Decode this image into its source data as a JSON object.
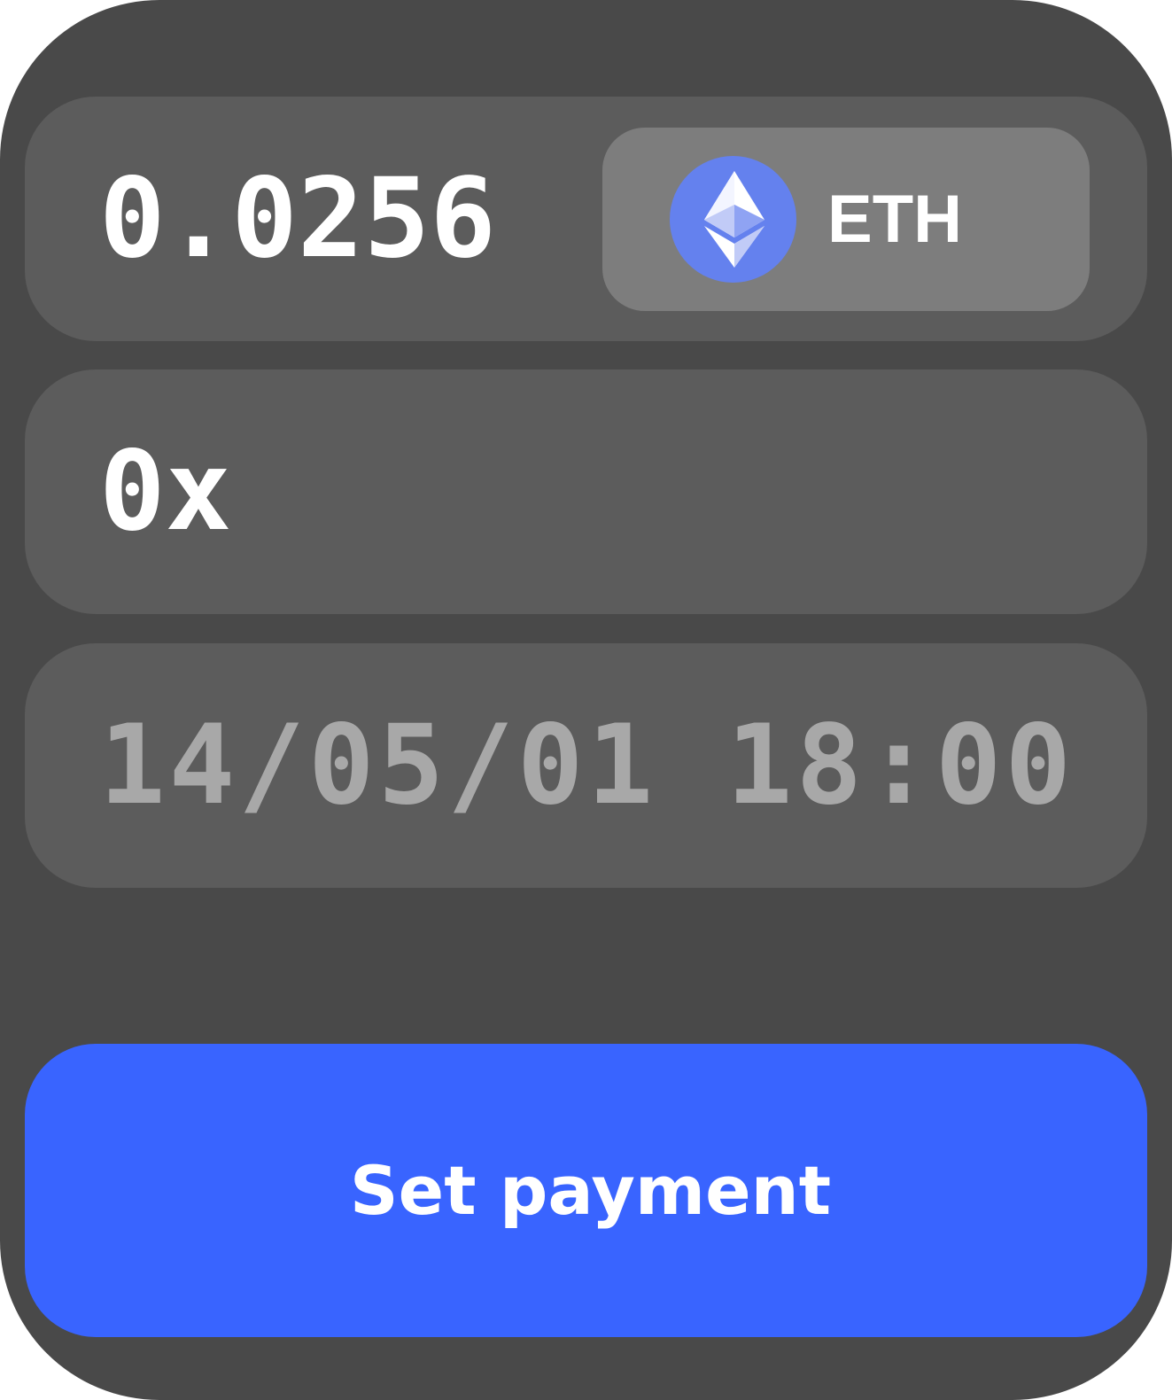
{
  "payment_form": {
    "amount": {
      "value": "0.0256"
    },
    "token_selector": {
      "symbol": "ETH",
      "icon": "ethereum-icon",
      "icon_color": "#6481ee"
    },
    "recipient_address": {
      "value": "0x"
    },
    "scheduled_datetime": {
      "placeholder": "14/05/01 18:00"
    },
    "submit_button": {
      "label": "Set payment",
      "color": "#3964ff"
    }
  },
  "colors": {
    "card_background": "#494949",
    "field_background": "#5c5c5c",
    "token_selector_background": "#7d7d7d",
    "placeholder_text": "#a8a8a8",
    "text": "#ffffff"
  }
}
